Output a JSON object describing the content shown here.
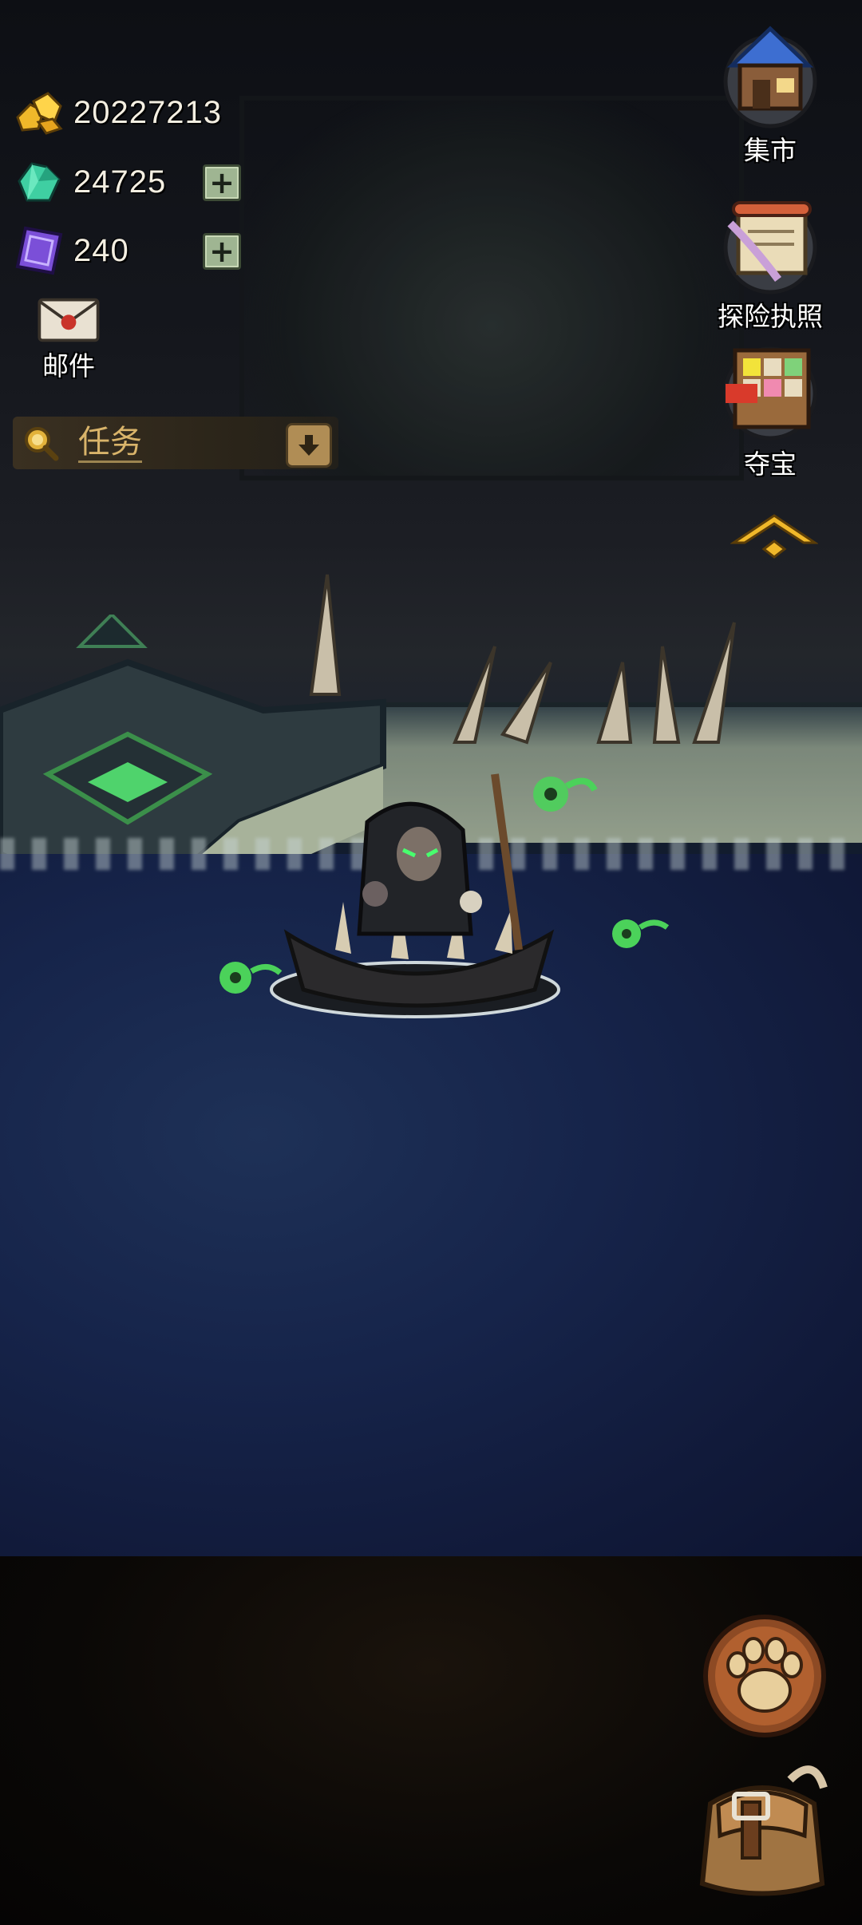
{
  "resources": {
    "gold": {
      "value": "20227213",
      "icon": "gold-nuggets-icon"
    },
    "gems": {
      "value": "24725",
      "icon": "green-crystal-icon"
    },
    "tickets": {
      "value": "240",
      "icon": "purple-card-icon"
    }
  },
  "mail": {
    "label": "邮件",
    "icon": "envelope-icon"
  },
  "quest": {
    "label": "任务",
    "icon": "magnifier-icon"
  },
  "side_menu": {
    "market": "集市",
    "license": "探险执照",
    "treasure": "夺宝"
  },
  "colors": {
    "gold_text": "#d9b46a",
    "label_text": "#ffffff",
    "water": "#16244a"
  }
}
